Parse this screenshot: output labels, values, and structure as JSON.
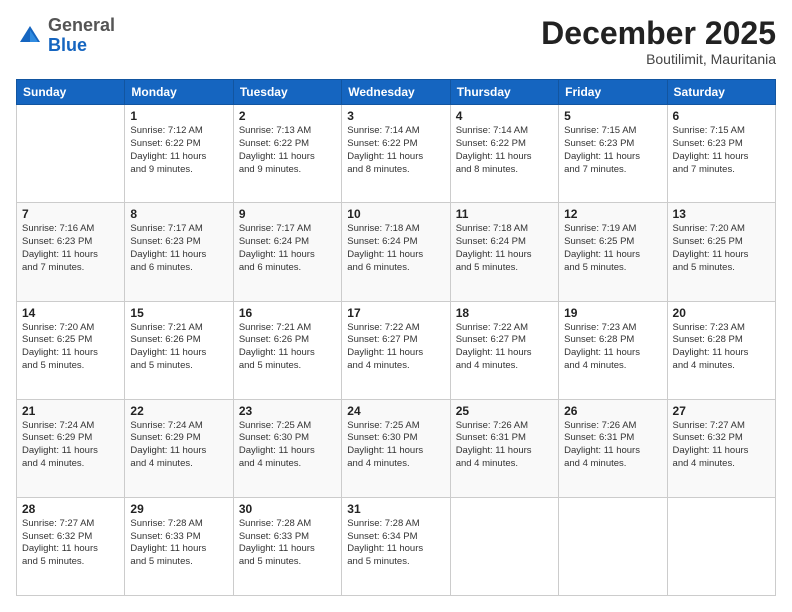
{
  "header": {
    "logo_line1": "General",
    "logo_line2": "Blue",
    "month": "December 2025",
    "location": "Boutilimit, Mauritania"
  },
  "weekdays": [
    "Sunday",
    "Monday",
    "Tuesday",
    "Wednesday",
    "Thursday",
    "Friday",
    "Saturday"
  ],
  "weeks": [
    [
      {
        "day": "",
        "info": ""
      },
      {
        "day": "1",
        "info": "Sunrise: 7:12 AM\nSunset: 6:22 PM\nDaylight: 11 hours\nand 9 minutes."
      },
      {
        "day": "2",
        "info": "Sunrise: 7:13 AM\nSunset: 6:22 PM\nDaylight: 11 hours\nand 9 minutes."
      },
      {
        "day": "3",
        "info": "Sunrise: 7:14 AM\nSunset: 6:22 PM\nDaylight: 11 hours\nand 8 minutes."
      },
      {
        "day": "4",
        "info": "Sunrise: 7:14 AM\nSunset: 6:22 PM\nDaylight: 11 hours\nand 8 minutes."
      },
      {
        "day": "5",
        "info": "Sunrise: 7:15 AM\nSunset: 6:23 PM\nDaylight: 11 hours\nand 7 minutes."
      },
      {
        "day": "6",
        "info": "Sunrise: 7:15 AM\nSunset: 6:23 PM\nDaylight: 11 hours\nand 7 minutes."
      }
    ],
    [
      {
        "day": "7",
        "info": "Sunrise: 7:16 AM\nSunset: 6:23 PM\nDaylight: 11 hours\nand 7 minutes."
      },
      {
        "day": "8",
        "info": "Sunrise: 7:17 AM\nSunset: 6:23 PM\nDaylight: 11 hours\nand 6 minutes."
      },
      {
        "day": "9",
        "info": "Sunrise: 7:17 AM\nSunset: 6:24 PM\nDaylight: 11 hours\nand 6 minutes."
      },
      {
        "day": "10",
        "info": "Sunrise: 7:18 AM\nSunset: 6:24 PM\nDaylight: 11 hours\nand 6 minutes."
      },
      {
        "day": "11",
        "info": "Sunrise: 7:18 AM\nSunset: 6:24 PM\nDaylight: 11 hours\nand 5 minutes."
      },
      {
        "day": "12",
        "info": "Sunrise: 7:19 AM\nSunset: 6:25 PM\nDaylight: 11 hours\nand 5 minutes."
      },
      {
        "day": "13",
        "info": "Sunrise: 7:20 AM\nSunset: 6:25 PM\nDaylight: 11 hours\nand 5 minutes."
      }
    ],
    [
      {
        "day": "14",
        "info": "Sunrise: 7:20 AM\nSunset: 6:25 PM\nDaylight: 11 hours\nand 5 minutes."
      },
      {
        "day": "15",
        "info": "Sunrise: 7:21 AM\nSunset: 6:26 PM\nDaylight: 11 hours\nand 5 minutes."
      },
      {
        "day": "16",
        "info": "Sunrise: 7:21 AM\nSunset: 6:26 PM\nDaylight: 11 hours\nand 5 minutes."
      },
      {
        "day": "17",
        "info": "Sunrise: 7:22 AM\nSunset: 6:27 PM\nDaylight: 11 hours\nand 4 minutes."
      },
      {
        "day": "18",
        "info": "Sunrise: 7:22 AM\nSunset: 6:27 PM\nDaylight: 11 hours\nand 4 minutes."
      },
      {
        "day": "19",
        "info": "Sunrise: 7:23 AM\nSunset: 6:28 PM\nDaylight: 11 hours\nand 4 minutes."
      },
      {
        "day": "20",
        "info": "Sunrise: 7:23 AM\nSunset: 6:28 PM\nDaylight: 11 hours\nand 4 minutes."
      }
    ],
    [
      {
        "day": "21",
        "info": "Sunrise: 7:24 AM\nSunset: 6:29 PM\nDaylight: 11 hours\nand 4 minutes."
      },
      {
        "day": "22",
        "info": "Sunrise: 7:24 AM\nSunset: 6:29 PM\nDaylight: 11 hours\nand 4 minutes."
      },
      {
        "day": "23",
        "info": "Sunrise: 7:25 AM\nSunset: 6:30 PM\nDaylight: 11 hours\nand 4 minutes."
      },
      {
        "day": "24",
        "info": "Sunrise: 7:25 AM\nSunset: 6:30 PM\nDaylight: 11 hours\nand 4 minutes."
      },
      {
        "day": "25",
        "info": "Sunrise: 7:26 AM\nSunset: 6:31 PM\nDaylight: 11 hours\nand 4 minutes."
      },
      {
        "day": "26",
        "info": "Sunrise: 7:26 AM\nSunset: 6:31 PM\nDaylight: 11 hours\nand 4 minutes."
      },
      {
        "day": "27",
        "info": "Sunrise: 7:27 AM\nSunset: 6:32 PM\nDaylight: 11 hours\nand 4 minutes."
      }
    ],
    [
      {
        "day": "28",
        "info": "Sunrise: 7:27 AM\nSunset: 6:32 PM\nDaylight: 11 hours\nand 5 minutes."
      },
      {
        "day": "29",
        "info": "Sunrise: 7:28 AM\nSunset: 6:33 PM\nDaylight: 11 hours\nand 5 minutes."
      },
      {
        "day": "30",
        "info": "Sunrise: 7:28 AM\nSunset: 6:33 PM\nDaylight: 11 hours\nand 5 minutes."
      },
      {
        "day": "31",
        "info": "Sunrise: 7:28 AM\nSunset: 6:34 PM\nDaylight: 11 hours\nand 5 minutes."
      },
      {
        "day": "",
        "info": ""
      },
      {
        "day": "",
        "info": ""
      },
      {
        "day": "",
        "info": ""
      }
    ]
  ]
}
